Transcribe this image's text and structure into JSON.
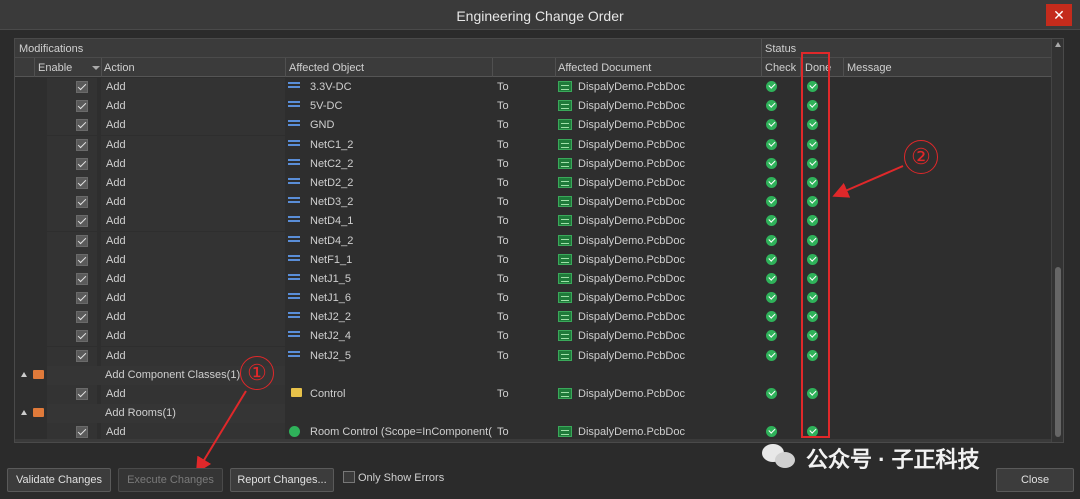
{
  "window": {
    "title": "Engineering Change Order",
    "close_glyph": "✕"
  },
  "grid": {
    "group_headers": {
      "modifications": "Modifications",
      "status": "Status"
    },
    "columns": {
      "enable": "Enable",
      "action": "Action",
      "affected_object": "Affected Object",
      "affected_document": "Affected Document",
      "check": "Check",
      "done": "Done",
      "message": "Message"
    },
    "rows": [
      {
        "kind": "item",
        "action": "Add",
        "object": "3.3V-DC",
        "to": "To",
        "document": "DispalyDemo.PcbDoc",
        "icon": "net-icon"
      },
      {
        "kind": "item",
        "action": "Add",
        "object": "5V-DC",
        "to": "To",
        "document": "DispalyDemo.PcbDoc",
        "icon": "net-icon"
      },
      {
        "kind": "item",
        "action": "Add",
        "object": "GND",
        "to": "To",
        "document": "DispalyDemo.PcbDoc",
        "icon": "net-icon"
      },
      {
        "kind": "item",
        "action": "Add",
        "object": "NetC1_2",
        "to": "To",
        "document": "DispalyDemo.PcbDoc",
        "icon": "net-icon"
      },
      {
        "kind": "item",
        "action": "Add",
        "object": "NetC2_2",
        "to": "To",
        "document": "DispalyDemo.PcbDoc",
        "icon": "net-icon"
      },
      {
        "kind": "item",
        "action": "Add",
        "object": "NetD2_2",
        "to": "To",
        "document": "DispalyDemo.PcbDoc",
        "icon": "net-icon"
      },
      {
        "kind": "item",
        "action": "Add",
        "object": "NetD3_2",
        "to": "To",
        "document": "DispalyDemo.PcbDoc",
        "icon": "net-icon"
      },
      {
        "kind": "item",
        "action": "Add",
        "object": "NetD4_1",
        "to": "To",
        "document": "DispalyDemo.PcbDoc",
        "icon": "net-icon"
      },
      {
        "kind": "item",
        "action": "Add",
        "object": "NetD4_2",
        "to": "To",
        "document": "DispalyDemo.PcbDoc",
        "icon": "net-icon"
      },
      {
        "kind": "item",
        "action": "Add",
        "object": "NetF1_1",
        "to": "To",
        "document": "DispalyDemo.PcbDoc",
        "icon": "net-icon"
      },
      {
        "kind": "item",
        "action": "Add",
        "object": "NetJ1_5",
        "to": "To",
        "document": "DispalyDemo.PcbDoc",
        "icon": "net-icon"
      },
      {
        "kind": "item",
        "action": "Add",
        "object": "NetJ1_6",
        "to": "To",
        "document": "DispalyDemo.PcbDoc",
        "icon": "net-icon"
      },
      {
        "kind": "item",
        "action": "Add",
        "object": "NetJ2_2",
        "to": "To",
        "document": "DispalyDemo.PcbDoc",
        "icon": "net-icon"
      },
      {
        "kind": "item",
        "action": "Add",
        "object": "NetJ2_4",
        "to": "To",
        "document": "DispalyDemo.PcbDoc",
        "icon": "net-icon"
      },
      {
        "kind": "item",
        "action": "Add",
        "object": "NetJ2_5",
        "to": "To",
        "document": "DispalyDemo.PcbDoc",
        "icon": "net-icon"
      },
      {
        "kind": "group",
        "action": "Add Component Classes(1)"
      },
      {
        "kind": "item",
        "action": "Add",
        "object": "Control",
        "to": "To",
        "document": "DispalyDemo.PcbDoc",
        "icon": "folder-icon"
      },
      {
        "kind": "group",
        "action": "Add Rooms(1)"
      },
      {
        "kind": "item",
        "action": "Add",
        "object": "Room Control (Scope=InComponent(",
        "to": "To",
        "document": "DispalyDemo.PcbDoc",
        "icon": "room-icon"
      }
    ]
  },
  "annotations": {
    "marker_1": "①",
    "marker_2": "②",
    "accent_color": "#e0282a"
  },
  "buttons": {
    "validate": "Validate Changes",
    "execute": "Execute Changes",
    "report": "Report Changes...",
    "only_errors": "Only Show Errors",
    "close": "Close"
  },
  "watermark": {
    "text": "公众号 · 子正科技",
    "icon": "wechat-icon"
  }
}
